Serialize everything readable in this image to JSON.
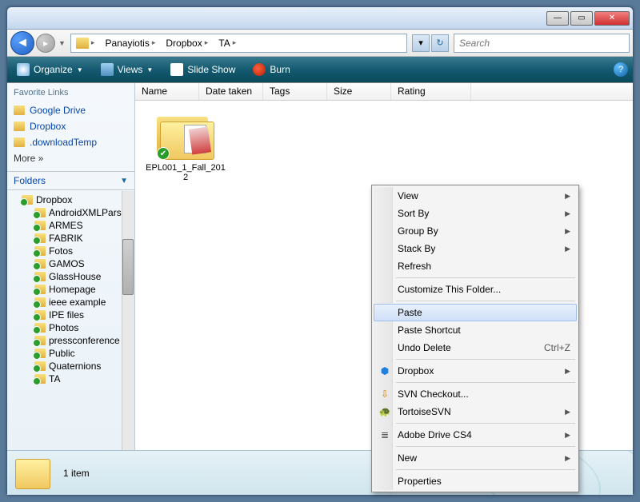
{
  "breadcrumb": [
    "Panayiotis",
    "Dropbox",
    "TA"
  ],
  "search": {
    "placeholder": "Search"
  },
  "toolbar": {
    "organize": "Organize",
    "views": "Views",
    "slideshow": "Slide Show",
    "burn": "Burn"
  },
  "favlinks": {
    "title": "Favorite Links",
    "items": [
      "Google Drive",
      "Dropbox",
      ".downloadTemp"
    ],
    "more": "More »"
  },
  "folders": {
    "title": "Folders",
    "root": "Dropbox",
    "children": [
      "AndroidXMLPars",
      "ARMES",
      "FABRIK",
      "Fotos",
      "GAMOS",
      "GlassHouse",
      "Homepage",
      "ieee example",
      "IPE files",
      "Photos",
      "pressconference",
      "Public",
      "Quaternions",
      "TA"
    ]
  },
  "columns": {
    "name": "Name",
    "date": "Date taken",
    "tags": "Tags",
    "size": "Size",
    "rating": "Rating"
  },
  "items": [
    {
      "label": "EPL001_1_Fall_2012"
    }
  ],
  "status": {
    "count": "1 item"
  },
  "context": {
    "view": "View",
    "sortby": "Sort By",
    "groupby": "Group By",
    "stackby": "Stack By",
    "refresh": "Refresh",
    "customize": "Customize This Folder...",
    "paste": "Paste",
    "paste_shortcut": "Paste Shortcut",
    "undo": "Undo Delete",
    "undo_key": "Ctrl+Z",
    "dropbox": "Dropbox",
    "svn": "SVN Checkout...",
    "tortoise": "TortoiseSVN",
    "adobe": "Adobe Drive CS4",
    "new": "New",
    "properties": "Properties"
  }
}
